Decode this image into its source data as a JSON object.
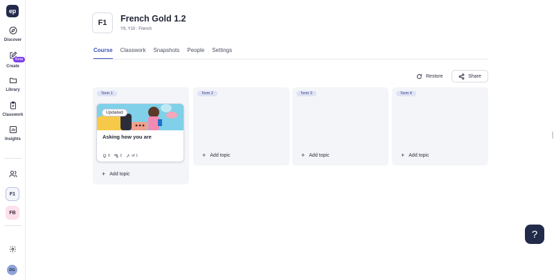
{
  "sidebar": {
    "logo": "ep",
    "items": [
      {
        "label": "Discover"
      },
      {
        "label": "Create",
        "badge": "Beta"
      },
      {
        "label": "Library"
      },
      {
        "label": "Classwork"
      },
      {
        "label": "Insights"
      }
    ],
    "courses": [
      "F1",
      "FB"
    ],
    "avatar": "DG"
  },
  "header": {
    "badge": "F1",
    "title": "French Gold 1.2",
    "subtitle": "Y9, Y10 : French"
  },
  "tabs": [
    {
      "label": "Course",
      "active": true
    },
    {
      "label": "Classwork"
    },
    {
      "label": "Snapshots"
    },
    {
      "label": "People"
    },
    {
      "label": "Settings"
    }
  ],
  "toolbar": {
    "restore_label": "Restore",
    "share_label": "Share"
  },
  "terms": [
    {
      "label": "Term 1",
      "card": {
        "badge": "Updated",
        "title": "Asking how you are",
        "lessons": "6",
        "activities": "2",
        "progress": "of 1"
      },
      "add_label": "Add topic"
    },
    {
      "label": "Term 2",
      "add_label": "Add topic"
    },
    {
      "label": "Term 3",
      "add_label": "Add topic"
    },
    {
      "label": "Term 4",
      "add_label": "Add topic"
    }
  ],
  "help_label": "?",
  "colors": {
    "accent": "#3b4fb8",
    "navy": "#232b4b",
    "beta": "#7c3aed",
    "term_bg": "#f4f5f9",
    "term_chip": "#dfe3f6"
  }
}
